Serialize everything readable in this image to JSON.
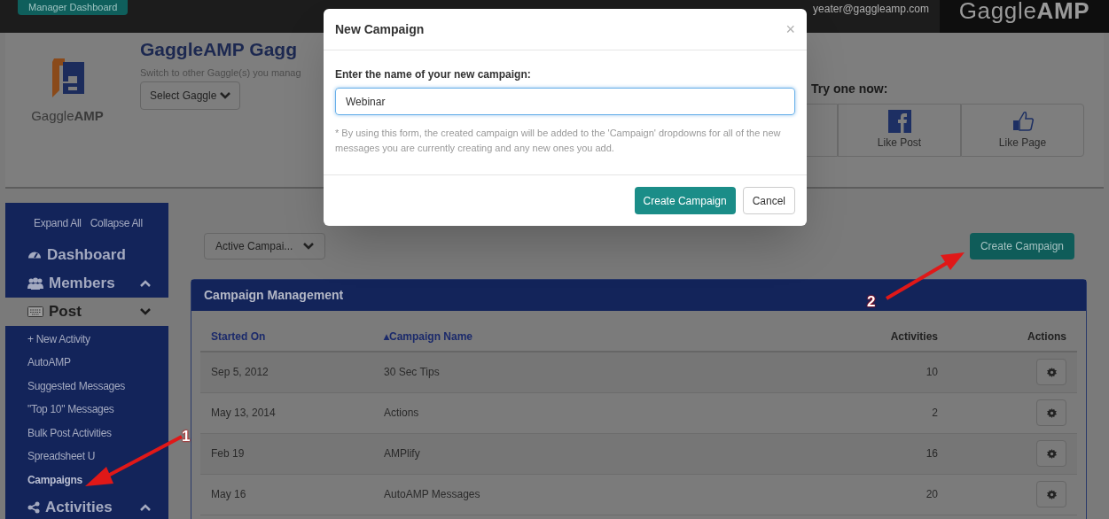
{
  "top_bar": {
    "dashboard_menu": "Manager Dashboard",
    "user_menu": "yeater@gaggleamp.com",
    "logo": "Gaggle**AMP**"
  },
  "header": {
    "logo_text": "Gaggle**AMP**",
    "title": "GaggleAMP Gagg",
    "subtitle": "Switch to other Gaggle(s) you manag",
    "gaggle_select": "Select Gaggle",
    "try_title": "Try one now:",
    "try_options": [
      {
        "kind": "covered"
      },
      {
        "kind": "facebook",
        "label": "Like Post"
      },
      {
        "kind": "thumb",
        "label": "Like Page"
      }
    ]
  },
  "sidebar": {
    "links": [
      "Expand All",
      "Collapse All"
    ],
    "sections": [
      {
        "kind": "dashboard",
        "label": "Dashboard"
      },
      {
        "kind": "members",
        "label": "Members",
        "expanded": false
      },
      {
        "kind": "post",
        "label": "Post",
        "expanded": true,
        "children": [
          {
            "label": "+ New Activity",
            "selected": false
          },
          {
            "label": "AutoAMP",
            "selected": false
          },
          {
            "label": "Suggested Messages",
            "selected": false
          },
          {
            "label": "\"Top 10\" Messages",
            "selected": false
          },
          {
            "label": "Bulk Post Activities",
            "selected": false
          },
          {
            "label": "Spreadsheet U",
            "selected": false
          },
          {
            "label": "Campaigns",
            "selected": true
          }
        ]
      },
      {
        "kind": "activities",
        "label": "Activities",
        "expanded": false
      }
    ]
  },
  "main": {
    "filter": "Active Campai...",
    "create_button": "Create Campaign",
    "panel_title": "Campaign Management",
    "columns": [
      {
        "label": "Started On",
        "sortable": true
      },
      {
        "label": "▴Campaign Name",
        "sortable": true
      },
      {
        "label": "Activities",
        "sortable": false
      },
      {
        "label": "Actions",
        "sortable": false
      }
    ],
    "rows": [
      {
        "started": "Sep 5, 2012",
        "name": "30 Sec Tips",
        "activities": "10"
      },
      {
        "started": "May 13, 2014",
        "name": "Actions",
        "activities": "2"
      },
      {
        "started": "Feb 19",
        "name": "AMPlify",
        "activities": "16"
      },
      {
        "started": "May 16",
        "name": "AutoAMP Messages",
        "activities": "20"
      }
    ]
  },
  "modal": {
    "title": "New Campaign",
    "close": "×",
    "label": "Enter the name of your new campaign:",
    "value": "Webinar",
    "note": "* By using this form, the created campaign will be added to the 'Campaign' dropdowns for all of the new messages you are currently creating and any new ones you add.",
    "buttons": [
      {
        "label": "Create Campaign",
        "primary": true
      },
      {
        "label": "Cancel",
        "primary": false
      }
    ]
  },
  "annotations": [
    {
      "label": "1"
    },
    {
      "label": "2"
    }
  ]
}
